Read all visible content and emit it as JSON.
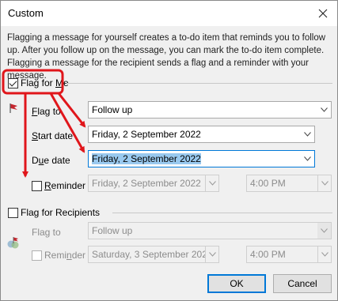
{
  "window": {
    "title": "Custom"
  },
  "description": "Flagging a message for yourself creates a to-do item that reminds you to follow up. After you follow up on the message, you can mark the to-do item complete. Flagging a message for the recipient sends a flag and a reminder with your message.",
  "flag_for_me": {
    "label_pre": "Flag for ",
    "label_key": "M",
    "label_post": "e",
    "checked": true,
    "flag_to": {
      "label_key": "F",
      "label_rest": "lag to",
      "value": "Follow up"
    },
    "start_date": {
      "label_key": "S",
      "label_rest": "tart date",
      "value": "Friday, 2 September 2022"
    },
    "due_date": {
      "label_pre": "D",
      "label_key": "u",
      "label_rest": "e date",
      "value": "Friday, 2 September 2022"
    },
    "reminder": {
      "label_key": "R",
      "label_rest": "eminder",
      "checked": false,
      "date": "Friday, 2 September 2022",
      "time": "4:00 PM"
    }
  },
  "flag_for_recipients": {
    "label": "Flag for Recipients",
    "checked": false,
    "flag_to": {
      "label": "Flag to",
      "value": "Follow up"
    },
    "reminder": {
      "label_pre": "Remi",
      "label_key": "n",
      "label_post": "der",
      "checked": false,
      "date": "Saturday, 3 September 2022",
      "time": "4:00 PM"
    }
  },
  "buttons": {
    "ok": "OK",
    "cancel": "Cancel"
  },
  "colors": {
    "annotation": "#e0161b",
    "selection": "#99c9ef",
    "flag": "#c4262e",
    "focus": "#0078d7"
  }
}
